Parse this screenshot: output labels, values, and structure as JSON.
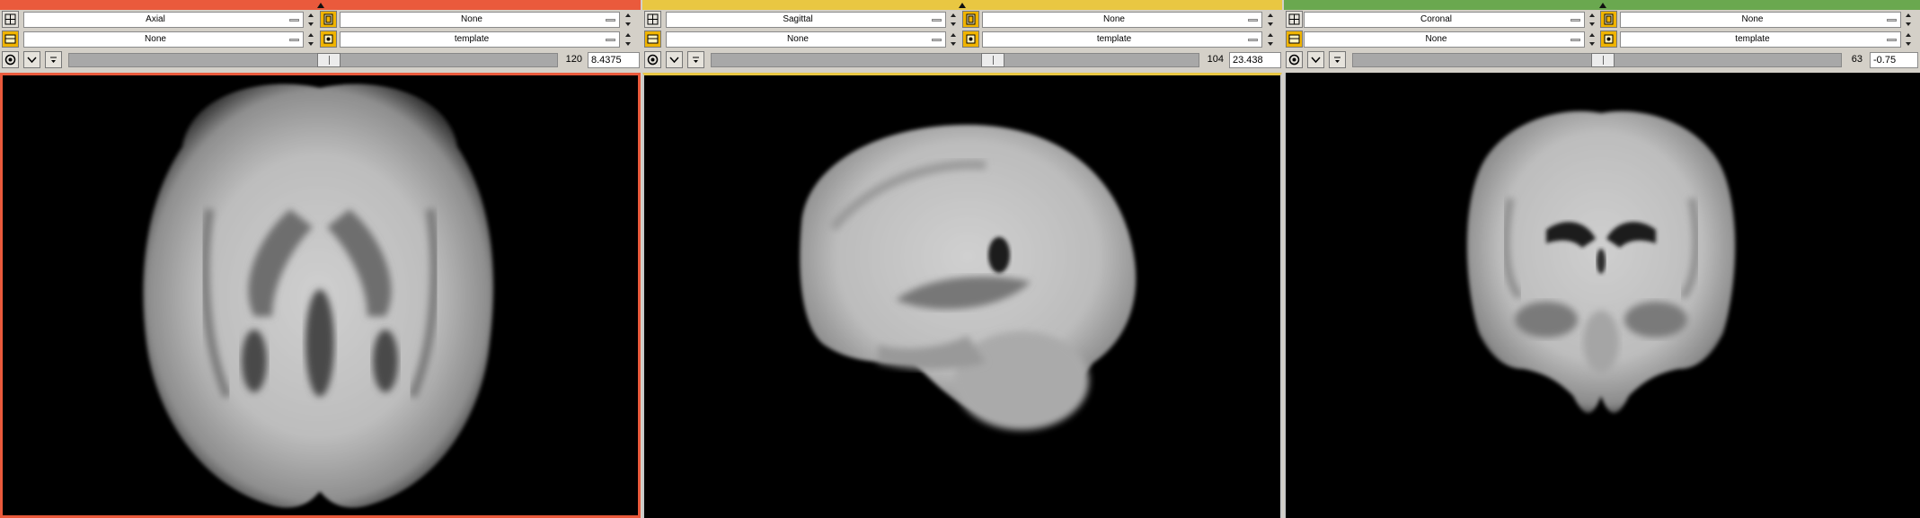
{
  "panels": {
    "axial": {
      "color": "#ea5a3c",
      "orientation": "Axial",
      "fg_volume": "None",
      "bg_volume": "None",
      "label_volume": "template",
      "slice_index": "120",
      "offset": "8.4375"
    },
    "sagittal": {
      "color": "#e9c742",
      "orientation": "Sagittal",
      "fg_volume": "None",
      "bg_volume": "None",
      "label_volume": "template",
      "slice_index": "104",
      "offset": "23.438"
    },
    "coronal": {
      "color": "#6aa84f",
      "orientation": "Coronal",
      "fg_volume": "None",
      "bg_volume": "None",
      "label_volume": "template",
      "slice_index": "63",
      "offset": "-0.75"
    }
  },
  "icons": {
    "layout": "grid-layout-icon",
    "volume": "volume-select-icon",
    "link": "link-icon",
    "expand": "chevron-down-icon",
    "pin": "pin-icon"
  }
}
